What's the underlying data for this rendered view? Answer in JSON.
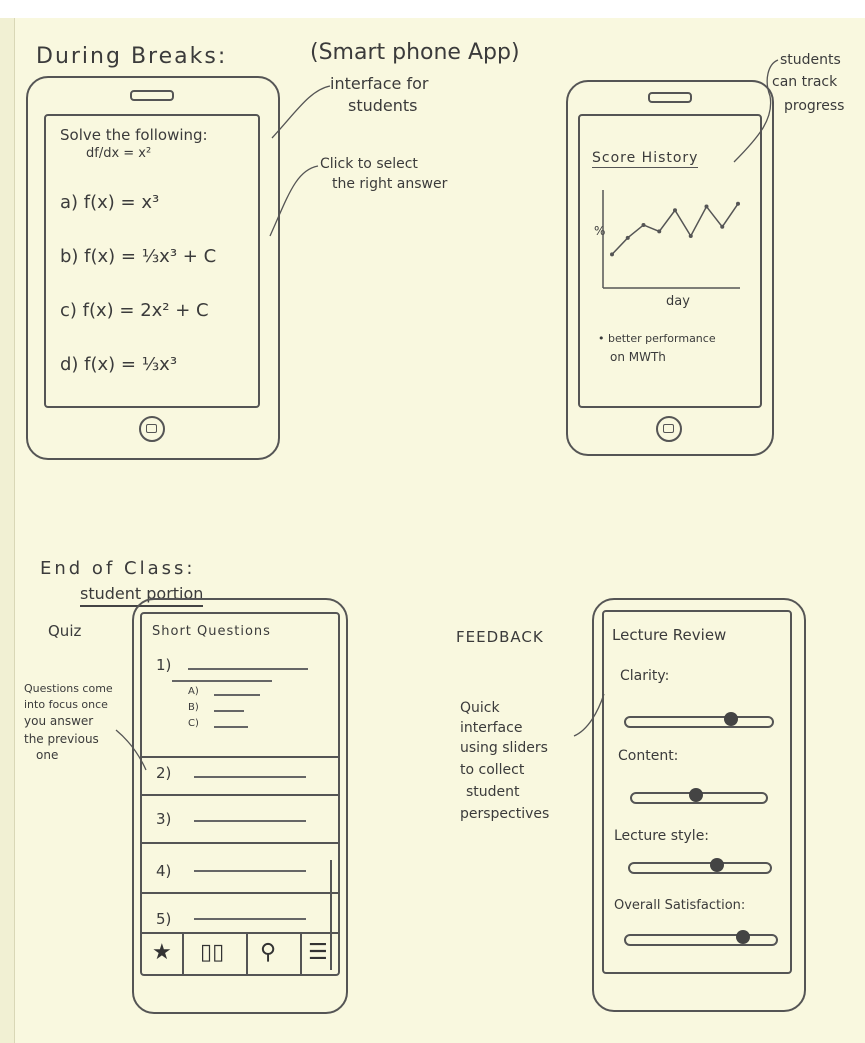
{
  "sections": {
    "during_breaks": "During Breaks:",
    "smartphone_app": "(Smart phone App)",
    "end_of_class": "End of Class:",
    "student_portion": "student portion"
  },
  "annotations": {
    "interface_for_students": [
      "interface for",
      "students"
    ],
    "click_to_select": [
      "Click to select",
      "the right answer"
    ],
    "students_track": [
      "students",
      "can track",
      "progress"
    ],
    "quiz_label": "Quiz",
    "feedback_label": "FEEDBACK",
    "questions_focus": [
      "Questions come",
      "into focus once",
      "you answer",
      "the previous",
      "one"
    ],
    "quick_interface": [
      "Quick",
      "interface",
      "using sliders",
      "to collect",
      "student",
      "perspectives"
    ]
  },
  "phone1": {
    "prompt": "Solve the following:",
    "equation": "df/dx = x²",
    "options": [
      "a) f(x) = x³",
      "b) f(x) = ⅓x³ + C",
      "c) f(x) = 2x² + C",
      "d) f(x) = ⅓x³"
    ]
  },
  "phone2": {
    "title": "Score History",
    "y_label": "%",
    "x_label": "day",
    "note": [
      "• better performance",
      "on MWTh"
    ]
  },
  "chart_data": {
    "type": "line",
    "title": "Score History",
    "xlabel": "day",
    "ylabel": "%",
    "series": [
      {
        "values": [
          30,
          48,
          62,
          55,
          78,
          50,
          82,
          60,
          85
        ]
      }
    ]
  },
  "phone3": {
    "title": "Short Questions",
    "q1": "1)",
    "sub_options": [
      "A)",
      "B)",
      "C)"
    ],
    "questions": [
      "2)",
      "3)",
      "4)",
      "5)"
    ],
    "icons": [
      "star-icon",
      "book-icon",
      "search-icon",
      "list-icon"
    ]
  },
  "phone4": {
    "title": "Lecture Review",
    "sliders": [
      {
        "label": "Clarity:",
        "value": 0.72
      },
      {
        "label": "Content:",
        "value": 0.48
      },
      {
        "label": "Lecture style:",
        "value": 0.62
      },
      {
        "label": "Overall Satisfaction:",
        "value": 0.78
      }
    ]
  }
}
